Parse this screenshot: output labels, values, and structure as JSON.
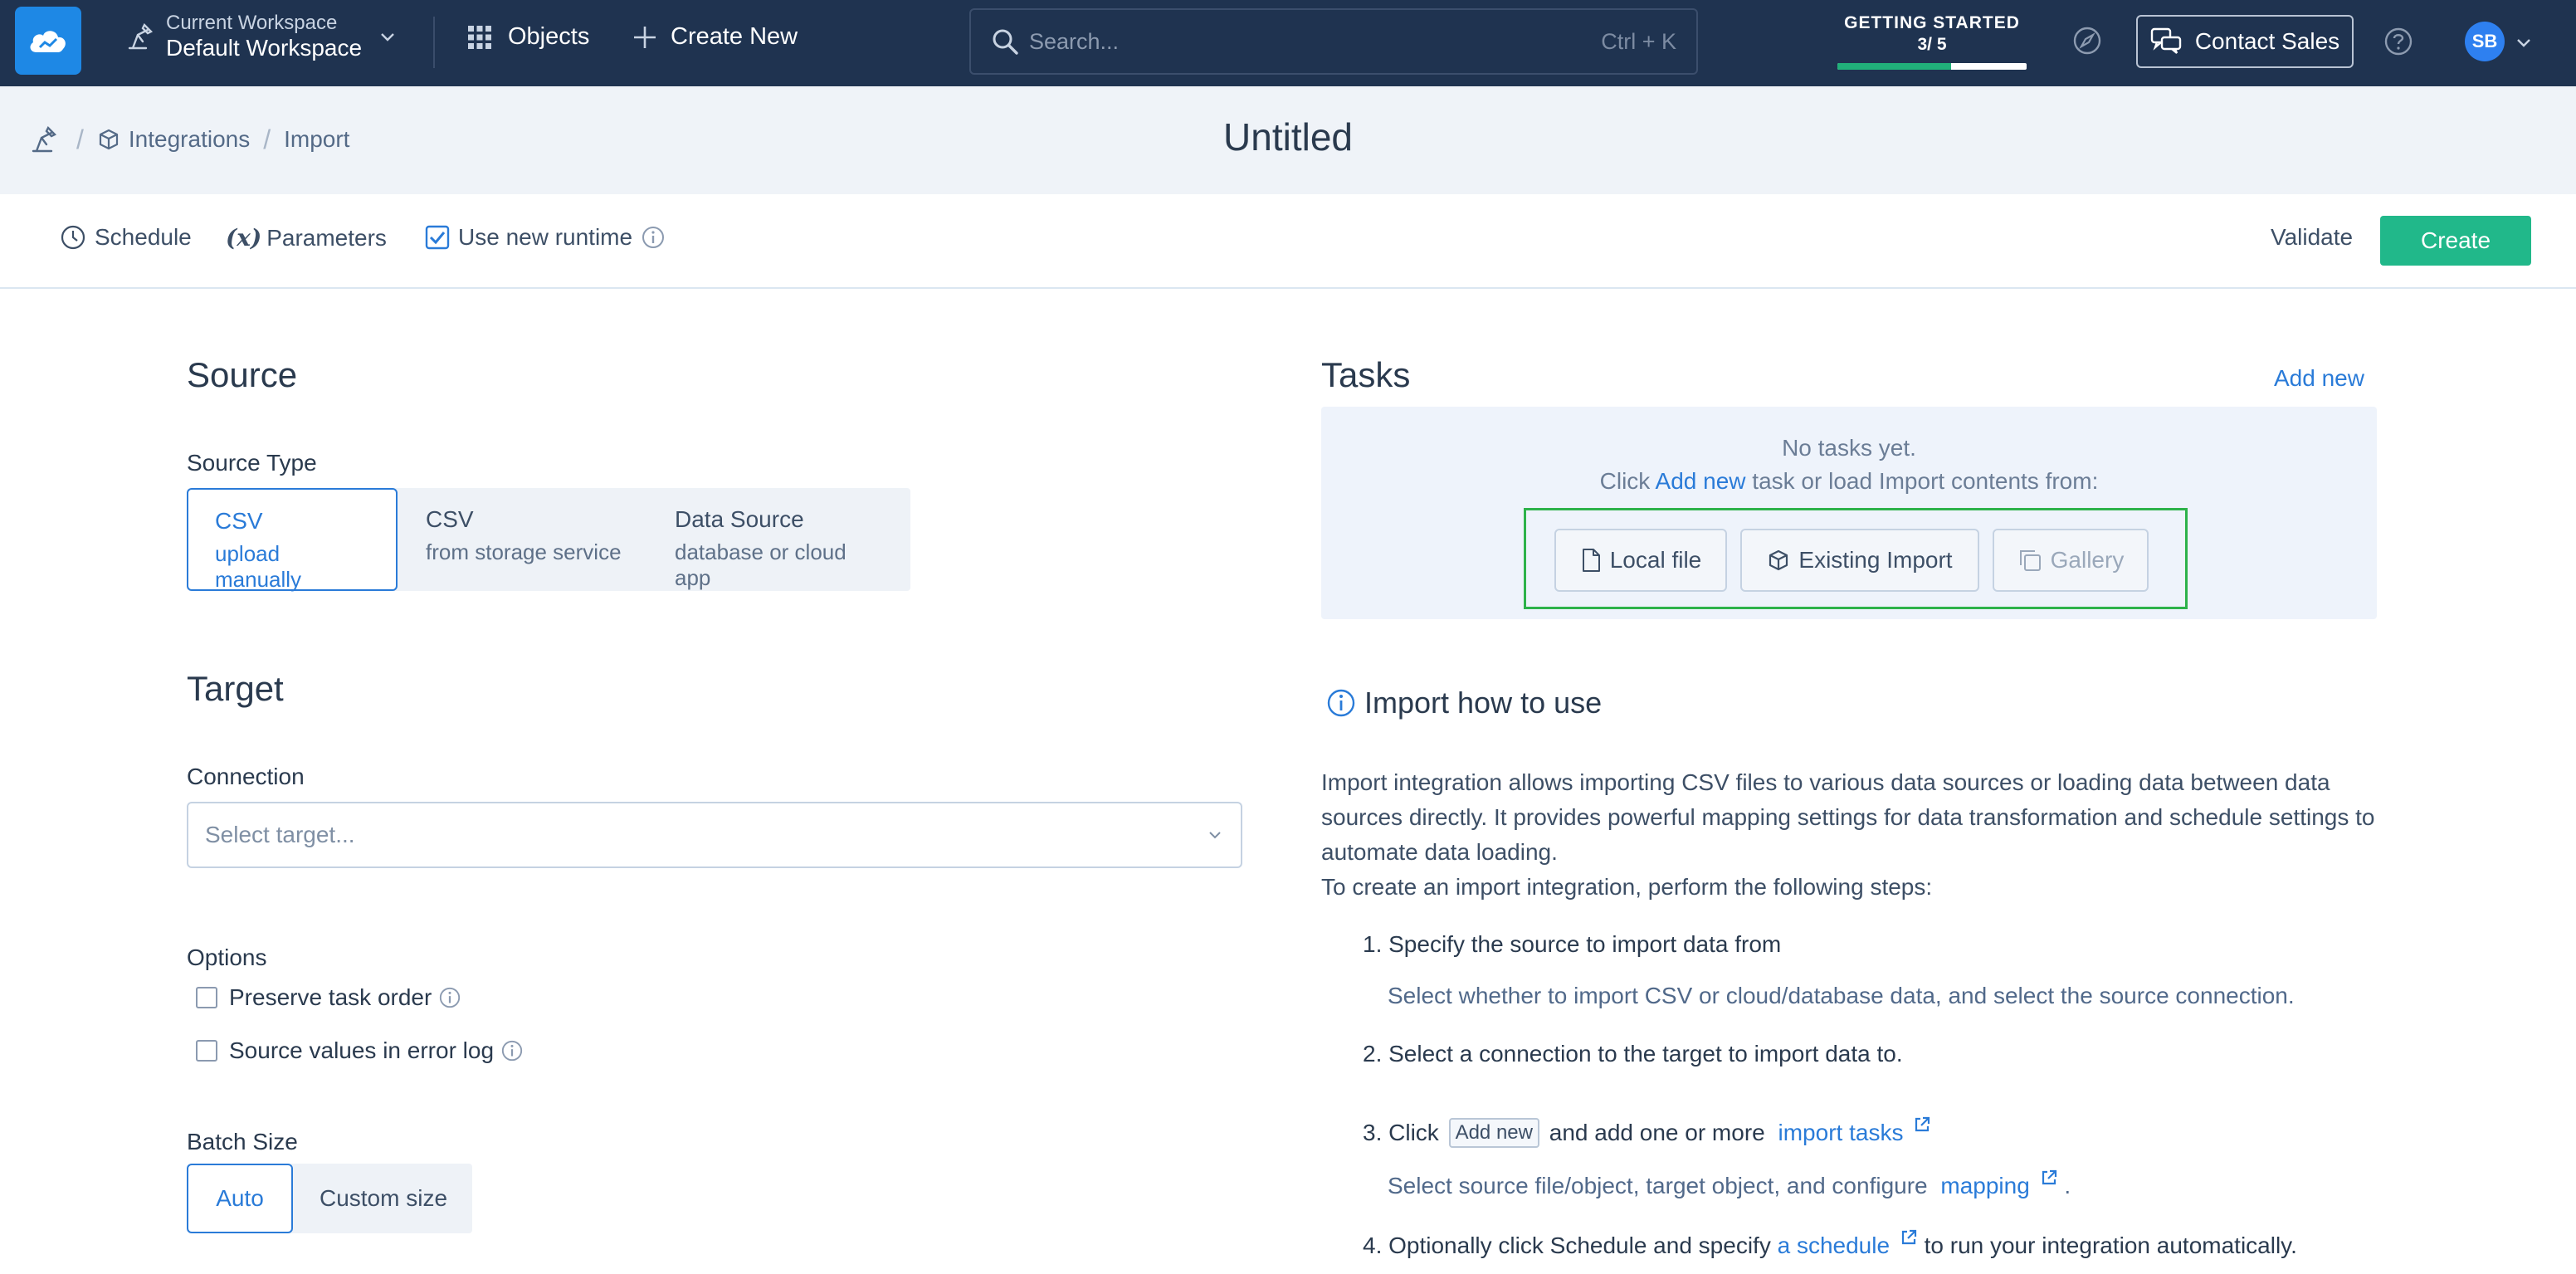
{
  "nav": {
    "workspace_caption": "Current Workspace",
    "workspace_name": "Default Workspace",
    "objects_label": "Objects",
    "create_new_label": "Create New",
    "search_placeholder": "Search...",
    "search_shortcut": "Ctrl + K",
    "getting_started_title": "GETTING STARTED",
    "getting_started_count": "3/ 5",
    "getting_started_progress": 0.6,
    "contact_sales_label": "Contact Sales",
    "avatar_initials": "SB"
  },
  "breadcrumb": {
    "items": [
      "Integrations",
      "Import"
    ]
  },
  "page": {
    "title": "Untitled"
  },
  "toolbar": {
    "schedule_label": "Schedule",
    "parameters_prefix": "(x)",
    "parameters_label": "Parameters",
    "use_new_runtime_label": "Use new runtime",
    "use_new_runtime_checked": true,
    "validate_label": "Validate",
    "create_label": "Create"
  },
  "source": {
    "heading": "Source",
    "type_label": "Source Type",
    "options": [
      {
        "title": "CSV",
        "subtitle": "upload manually",
        "active": true
      },
      {
        "title": "CSV",
        "subtitle": "from storage service",
        "active": false
      },
      {
        "title": "Data Source",
        "subtitle": "database or cloud app",
        "active": false
      }
    ]
  },
  "target": {
    "heading": "Target",
    "connection_label": "Connection",
    "connection_placeholder": "Select target..."
  },
  "options": {
    "heading": "Options",
    "items": [
      {
        "label": "Preserve task order",
        "checked": false
      },
      {
        "label": "Source values in error log",
        "checked": false
      }
    ]
  },
  "batch": {
    "heading": "Batch Size",
    "options": [
      "Auto",
      "Custom size"
    ],
    "selected": "Auto"
  },
  "tasks": {
    "heading": "Tasks",
    "add_new_label": "Add new",
    "empty_text": "No tasks yet.",
    "hint_prefix": "Click",
    "hint_link": "Add new",
    "hint_suffix": "task or load Import contents from:",
    "buttons": [
      {
        "label": "Local file",
        "enabled": true
      },
      {
        "label": "Existing Import",
        "enabled": true
      },
      {
        "label": "Gallery",
        "enabled": false
      }
    ]
  },
  "howto": {
    "title": "Import how to use",
    "intro": "Import integration allows importing CSV files to various data sources or loading data between data sources directly. It provides powerful mapping settings for data transformation and schedule settings to automate data loading.",
    "steps_intro": "To create an import integration, perform the following steps:",
    "step1": "1. Specify the source to import data from",
    "step1_sub": "Select whether to import CSV or cloud/database data, and select the source connection.",
    "step2": "2. Select a connection to the target to import data to.",
    "step3_prefix": "3. Click",
    "step3_chip": "Add new",
    "step3_middle": "and add one or more",
    "step3_link": "import tasks",
    "step3_sub_prefix": "Select source file/object, target object, and configure",
    "step3_sub_link": "mapping",
    "step3_sub_suffix": ".",
    "step4_prefix": "4. Optionally click Schedule and specify",
    "step4_link": "a schedule",
    "step4_suffix": "to run your integration automatically."
  },
  "colors": {
    "nav_bg": "#1f3350",
    "accent_blue": "#2a7bd8",
    "create_green": "#21b88a",
    "highlight_frame": "#2db24a"
  }
}
